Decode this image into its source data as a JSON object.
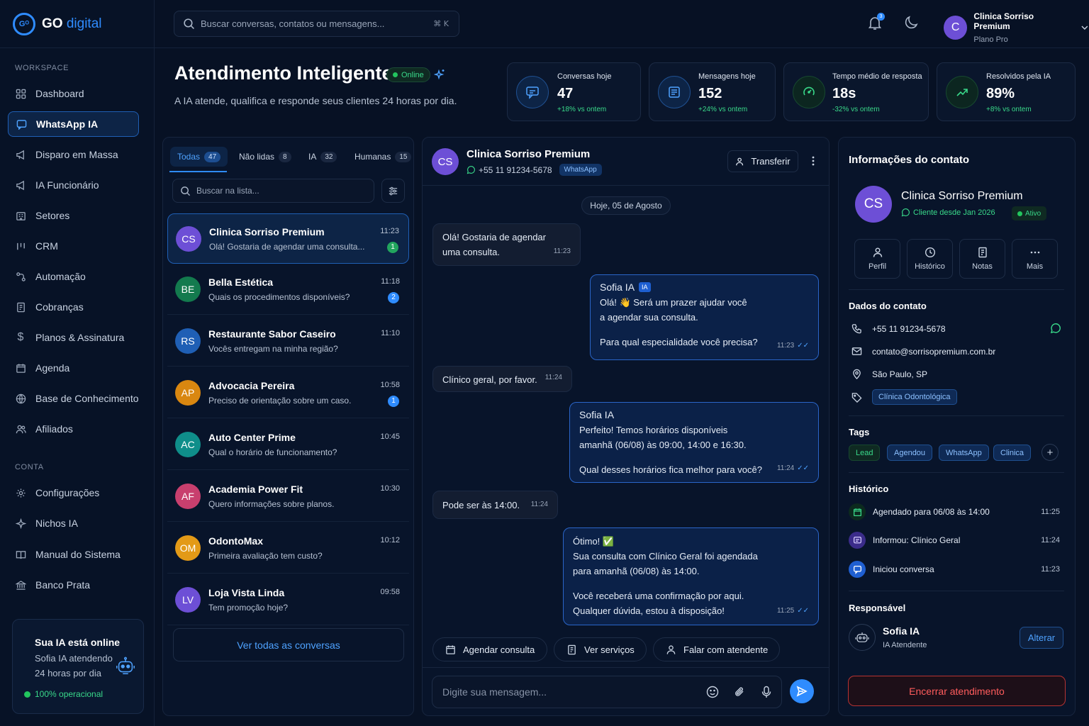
{
  "brand": {
    "name_a": "GO",
    "name_b": "digital",
    "mark": "Gᴼ"
  },
  "sidebar": {
    "workspace_label": "WORKSPACE",
    "account_label": "CONTA",
    "items": [
      {
        "label": "Dashboard",
        "icon": "grid-icon"
      },
      {
        "label": "WhatsApp IA",
        "icon": "chat-icon"
      },
      {
        "label": "Disparo em Massa",
        "icon": "megaphone-icon"
      },
      {
        "label": "IA Funcionário",
        "icon": "megaphone-icon"
      },
      {
        "label": "Setores",
        "icon": "building-icon"
      },
      {
        "label": "CRM",
        "icon": "columns-icon"
      },
      {
        "label": "Automação",
        "icon": "flow-icon"
      },
      {
        "label": "Cobranças",
        "icon": "invoice-icon"
      },
      {
        "label": "Planos & Assinatura",
        "icon": "dollar-icon"
      },
      {
        "label": "Agenda",
        "icon": "calendar-icon"
      },
      {
        "label": "Base de Conhecimento",
        "icon": "globe-icon"
      },
      {
        "label": "Afiliados",
        "icon": "users-icon"
      }
    ],
    "account_items": [
      {
        "label": "Configurações",
        "icon": "gear-icon"
      },
      {
        "label": "Nichos IA",
        "icon": "sparkle-icon"
      },
      {
        "label": "Manual do Sistema",
        "icon": "book-icon"
      },
      {
        "label": "Banco Prata",
        "icon": "bank-icon"
      }
    ],
    "ia_card": {
      "title": "Sua IA está online",
      "line1": "Sofia IA atendendo",
      "line2": "24 horas por dia",
      "status": "100% operacional"
    }
  },
  "topbar": {
    "search_placeholder": "Buscar conversas, contatos ou mensagens...",
    "shortcut": "⌘ K",
    "notif_count": "3",
    "user": {
      "initial": "C",
      "name": "Clinica Sorriso Premium",
      "plan": "Plano Pro"
    }
  },
  "header": {
    "title": "Atendimento Inteligente",
    "status": "Online",
    "subtitle": "A IA atende, qualifica e responde seus clientes 24 horas por dia."
  },
  "stats": [
    {
      "label": "Conversas hoje",
      "value": "47",
      "delta": "+18% vs ontem",
      "icon": "chat-icon"
    },
    {
      "label": "Mensagens hoje",
      "value": "152",
      "delta": "+24% vs ontem",
      "icon": "message-icon"
    },
    {
      "label": "Tempo médio de resposta",
      "value": "18s",
      "delta": "-32% vs ontem",
      "icon": "gauge-icon"
    },
    {
      "label": "Resolvidos pela IA",
      "value": "89%",
      "delta": "+8% vs ontem",
      "icon": "trend-icon"
    }
  ],
  "list": {
    "tabs": [
      {
        "label": "Todas",
        "count": "47"
      },
      {
        "label": "Não lidas",
        "count": "8"
      },
      {
        "label": "IA",
        "count": "32"
      },
      {
        "label": "Humanas",
        "count": "15"
      }
    ],
    "search_placeholder": "Buscar na lista...",
    "conversations": [
      {
        "initials": "CS",
        "name": "Clinica Sorriso Premium",
        "preview": "Olá! Gostaria de agendar uma consulta...",
        "time": "11:23",
        "badge": "1",
        "color": "#6d4fd6",
        "badge_color": "#22a55e"
      },
      {
        "initials": "BE",
        "name": "Bella Estética",
        "preview": "Quais os procedimentos disponíveis?",
        "time": "11:18",
        "badge": "2",
        "color": "#137a4e",
        "badge_color": "#2f8cff"
      },
      {
        "initials": "RS",
        "name": "Restaurante Sabor Caseiro",
        "preview": "Vocês entregam na minha região?",
        "time": "11:10",
        "badge": "",
        "color": "#1f5fb5",
        "badge_color": ""
      },
      {
        "initials": "AP",
        "name": "Advocacia Pereira",
        "preview": "Preciso de orientação sobre um caso.",
        "time": "10:58",
        "badge": "1",
        "color": "#d98710",
        "badge_color": "#2f8cff"
      },
      {
        "initials": "AC",
        "name": "Auto Center Prime",
        "preview": "Qual o horário de funcionamento?",
        "time": "10:45",
        "badge": "",
        "color": "#0f8e8a",
        "badge_color": ""
      },
      {
        "initials": "AF",
        "name": "Academia Power Fit",
        "preview": "Quero informações sobre planos.",
        "time": "10:30",
        "badge": "",
        "color": "#c83f6e",
        "badge_color": ""
      },
      {
        "initials": "OM",
        "name": "OdontoMax",
        "preview": "Primeira avaliação tem custo?",
        "time": "10:12",
        "badge": "",
        "color": "#e39a17",
        "badge_color": ""
      },
      {
        "initials": "LV",
        "name": "Loja Vista Linda",
        "preview": "Tem promoção hoje?",
        "time": "09:58",
        "badge": "",
        "color": "#6d4fd6",
        "badge_color": ""
      }
    ],
    "see_all": "Ver todas as conversas"
  },
  "chat": {
    "initials": "CS",
    "name": "Clinica Sorriso Premium",
    "phone": "+55 11 91234-5678",
    "channel": "WhatsApp",
    "transfer": "Transferir",
    "date": "Hoje, 05 de Agosto",
    "messages": [
      {
        "lines": [
          "Olá! Gostaria de agendar",
          "uma consulta."
        ],
        "time": "11:23"
      },
      {
        "author": "Sofia IA",
        "tag": "IA",
        "lines": [
          "Olá! 👋 Será um prazer ajudar você",
          "a agendar sua consulta.",
          "",
          "Para qual especialidade você precisa?"
        ],
        "time": "11:23"
      },
      {
        "lines": [
          "Clínico geral, por favor."
        ],
        "time": "11:24"
      },
      {
        "author": "Sofia IA",
        "lines": [
          "Perfeito! Temos horários disponíveis",
          "amanhã (06/08) às 09:00, 14:00 e 16:30.",
          "",
          "Qual desses horários fica melhor para você?"
        ],
        "time": "11:24"
      },
      {
        "lines": [
          "Pode ser às 14:00."
        ],
        "time": "11:24"
      },
      {
        "lines": [
          "Ótimo! ✅",
          "Sua consulta com Clínico Geral foi agendada",
          "para amanhã (06/08) às 14:00.",
          "",
          "Você receberá uma confirmação por aqui.",
          "Qualquer dúvida, estou à disposição!"
        ],
        "time": "11:25"
      }
    ],
    "quick_replies": [
      "Agendar consulta",
      "Ver serviços",
      "Falar com atendente"
    ],
    "composer_placeholder": "Digite sua mensagem..."
  },
  "contact": {
    "title": "Informações do contato",
    "initials": "CS",
    "name": "Clinica Sorriso Premium",
    "since": "Cliente desde Jan 2026",
    "status": "Ativo",
    "tabs": [
      "Perfil",
      "Histórico",
      "Notas",
      "Mais"
    ],
    "data_title": "Dados do contato",
    "phone": "+55 11 91234-5678",
    "email": "contato@sorrisopremium.com.br",
    "location": "São Paulo, SP",
    "segment": "Clínica Odontológica",
    "tags_title": "Tags",
    "tags": [
      "Lead",
      "Agendou",
      "WhatsApp",
      "Clinica"
    ],
    "history_title": "Histórico",
    "history": [
      {
        "text": "Agendado para 06/08 às 14:00",
        "time": "11:25"
      },
      {
        "text": "Informou: Clínico Geral",
        "time": "11:24"
      },
      {
        "text": "Iniciou conversa",
        "time": "11:23"
      }
    ],
    "responsible_title": "Responsável",
    "agent_name": "Sofia IA",
    "agent_role": "IA Atendente",
    "change": "Alterar",
    "end": "Encerrar atendimento"
  }
}
